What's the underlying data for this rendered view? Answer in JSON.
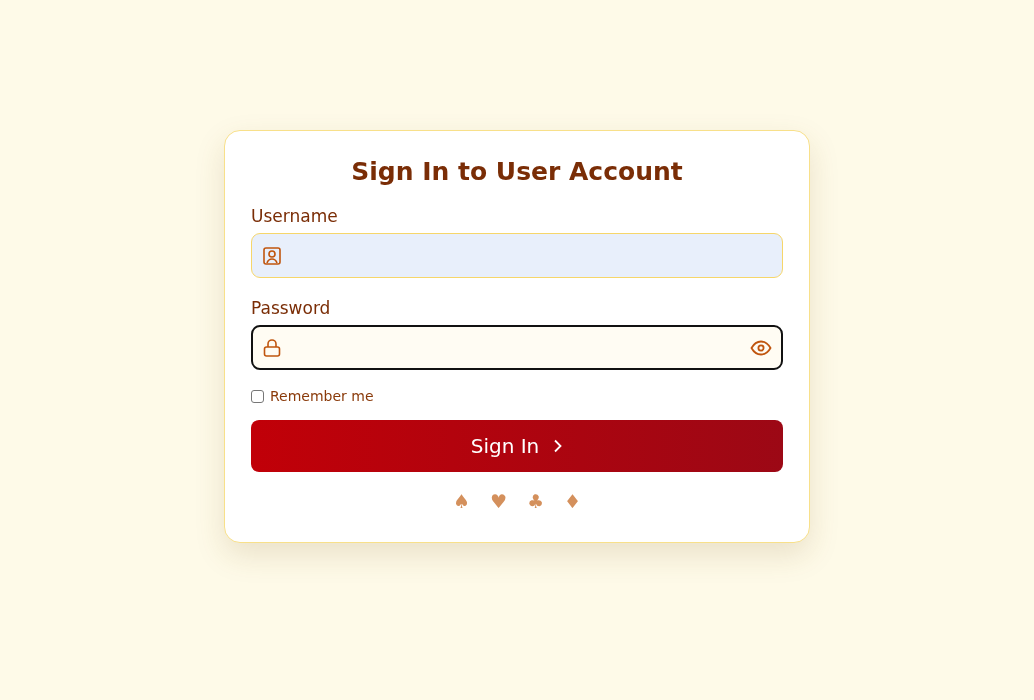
{
  "title": "Sign In to User Account",
  "fields": [
    {
      "kind": "username",
      "label": "Username",
      "focused": false,
      "autofilled": true
    },
    {
      "kind": "password",
      "label": "Password",
      "focused": true,
      "autofilled": false
    }
  ],
  "remember": {
    "label": "Remember me",
    "checked": false
  },
  "submit": {
    "label": "Sign In"
  },
  "suits": [
    "♠",
    "♥",
    "♣",
    "♦"
  ]
}
